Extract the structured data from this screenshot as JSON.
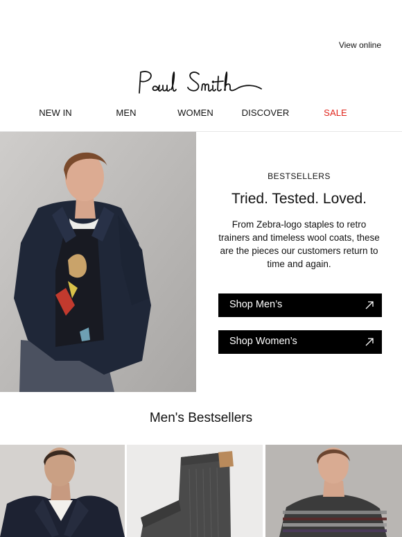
{
  "header": {
    "view_online": "View online",
    "logo_text": "Paul Smith"
  },
  "nav": {
    "items": [
      {
        "label": "NEW IN"
      },
      {
        "label": "MEN"
      },
      {
        "label": "WOMEN"
      },
      {
        "label": "DISCOVER"
      },
      {
        "label": "SALE"
      }
    ],
    "sale_color": "#e0241b"
  },
  "hero": {
    "eyebrow": "BESTSELLERS",
    "headline": "Tried. Tested. Loved.",
    "body": "From Zebra-logo staples to retro trainers and timeless wool coats, these are the pieces our customers return to time and again.",
    "cta_mens": "Shop Men’s",
    "cta_womens": "Shop Women’s"
  },
  "mens_bestsellers": {
    "title": "Men's Bestsellers"
  },
  "icons": {
    "cta_arrow": "arrow-up-right-icon"
  }
}
